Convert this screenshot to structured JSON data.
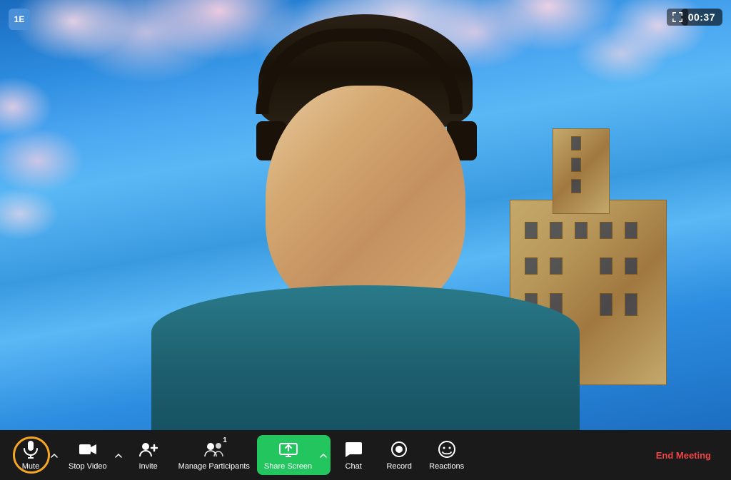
{
  "timer": "00:37",
  "top_left_badge": "1E",
  "toolbar": {
    "mute_label": "Mute",
    "stop_video_label": "Stop Video",
    "invite_label": "Invite",
    "manage_participants_label": "Manage Participants",
    "participants_count": "1",
    "share_screen_label": "Share Screen",
    "chat_label": "Chat",
    "record_label": "Record",
    "reactions_label": "Reactions",
    "end_meeting_label": "End Meeting"
  },
  "icons": {
    "microphone": "🎙",
    "video": "📹",
    "invite": "👤+",
    "participants": "👥",
    "share": "↑",
    "chat": "💬",
    "record": "⏺",
    "reactions": "😊",
    "expand": "⛶",
    "chevron": "▲"
  }
}
